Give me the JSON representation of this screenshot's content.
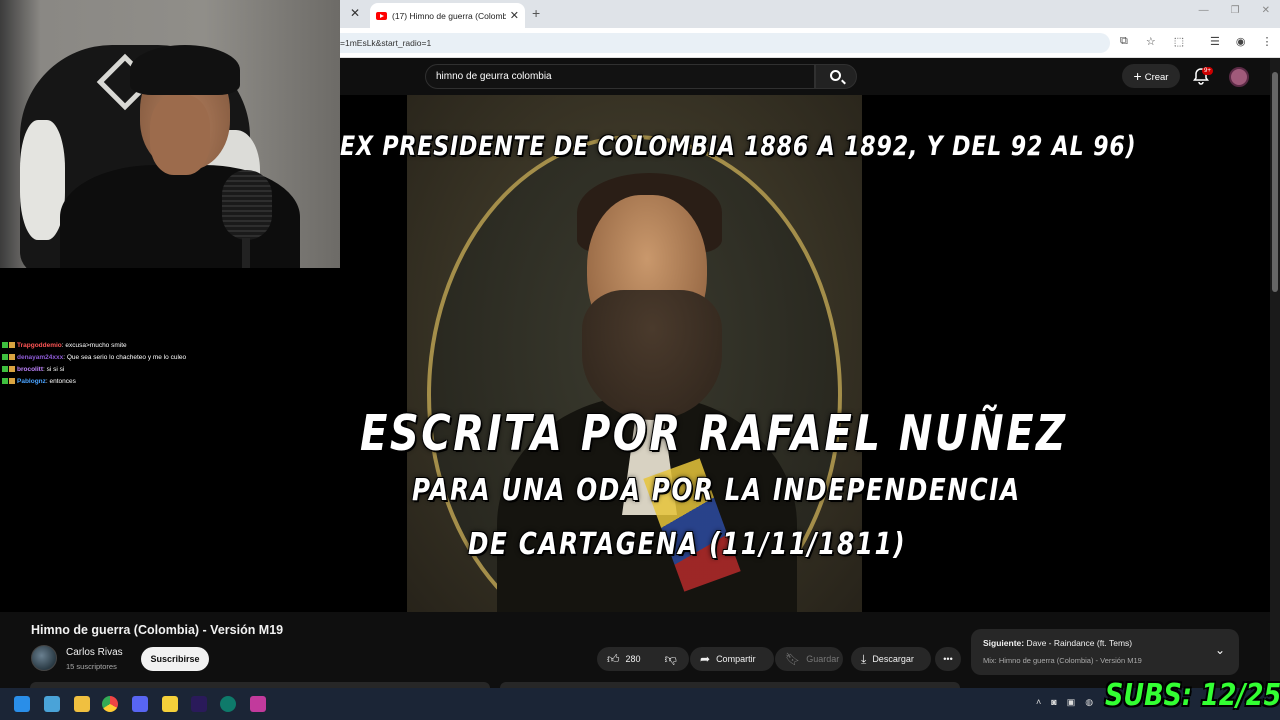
{
  "browser": {
    "tab_title": "(17) Himno de guerra (Colomb",
    "url": "=1mEsLk&start_radio=1"
  },
  "youtube": {
    "search_value": "himno de geurra colombia",
    "create_label": "Crear",
    "notification_badge": "9+"
  },
  "video": {
    "captions": {
      "line1": "EX PRESIDENTE DE COLOMBIA 1886 A 1892, Y DEL 92 AL 96)",
      "line2": "ESCRITA POR RAFAEL NUÑEZ",
      "line3": "PARA UNA ODA POR LA INDEPENDENCIA",
      "line4": "DE CARTAGENA (11/11/1811)"
    },
    "title": "Himno de guerra (Colombia) - Versión M19",
    "channel": {
      "name": "Carlos Rivas",
      "subscribers": "15 suscriptores",
      "subscribe_label": "Suscribirse"
    },
    "actions": {
      "likes": "280",
      "share_label": "Compartir",
      "save_label": "Guardar",
      "download_label": "Descargar"
    },
    "up_next": {
      "label": "Siguiente:",
      "title": "Dave - Raindance (ft. Tems)",
      "mix": "Mix: Himno de guerra (Colombia) - Versión M19"
    }
  },
  "chat": [
    {
      "user": "Trapgoddemio",
      "text": ": excusa>mucho smite",
      "color": "#ff5555"
    },
    {
      "user": "denayam24xxx",
      "text": ": Que sea serio lo chacheteo y me lo culeo",
      "color": "#8e5bd6"
    },
    {
      "user": "brocolitt",
      "text": ": si si si",
      "color": "#c084ff"
    },
    {
      "user": "Pablognz",
      "text": ": entonces",
      "color": "#4aa3ff"
    }
  ],
  "overlay": {
    "subs": "SUBS: 12/25"
  },
  "colors": {
    "yt_bg": "#0f0f0f",
    "subs_green": "#33ff33",
    "taskbar": "#1b2536"
  }
}
